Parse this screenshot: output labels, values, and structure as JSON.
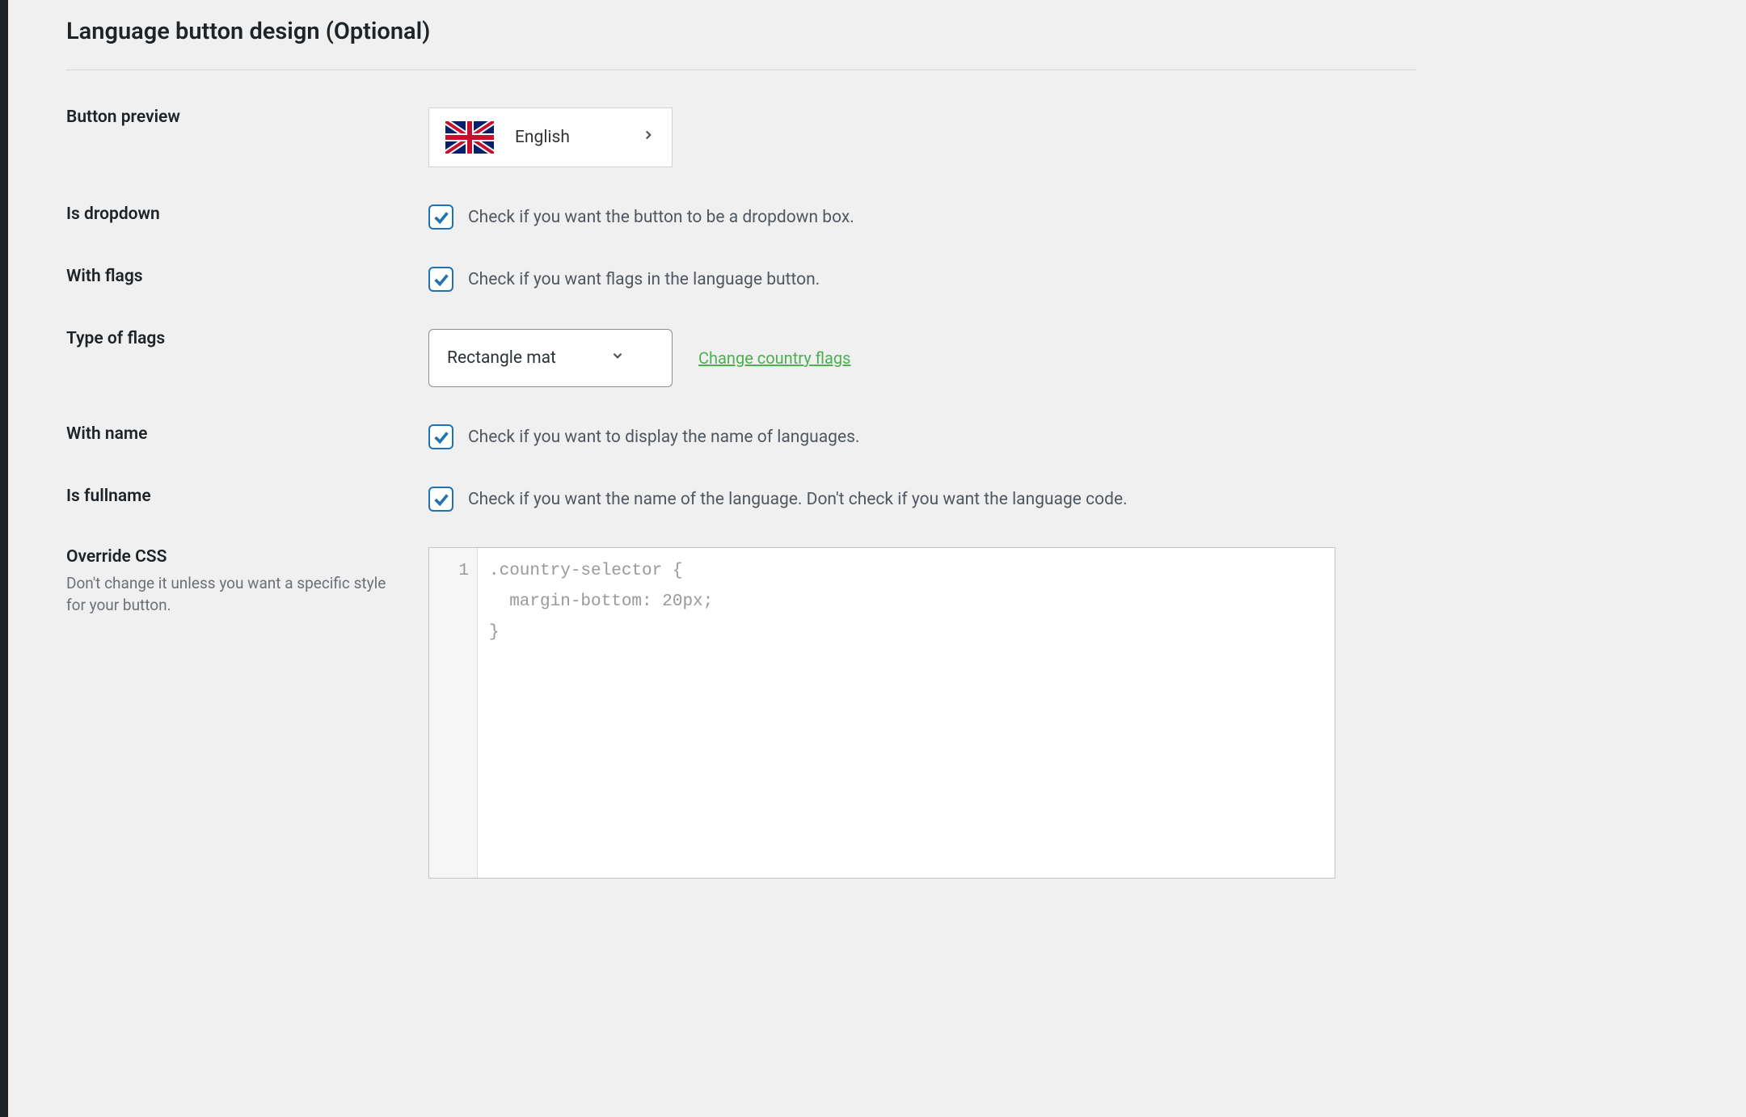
{
  "section": {
    "title": "Language button design (Optional)"
  },
  "rows": {
    "preview": {
      "label": "Button preview",
      "language": "English"
    },
    "dropdown": {
      "label": "Is dropdown",
      "desc": "Check if you want the button to be a dropdown box."
    },
    "flags": {
      "label": "With flags",
      "desc": "Check if you want flags in the language button."
    },
    "flag_type": {
      "label": "Type of flags",
      "select": "Rectangle mat",
      "link": "Change country flags"
    },
    "with_name": {
      "label": "With name",
      "desc": "Check if you want to display the name of languages."
    },
    "fullname": {
      "label": "Is fullname",
      "desc": "Check if you want the name of the language. Don't check if you want the language code."
    },
    "override": {
      "label": "Override CSS",
      "sub": "Don't change it unless you want a specific style for your button."
    }
  },
  "code": {
    "line_number": "1",
    "content": ".country-selector {\n  margin-bottom: 20px;\n}"
  }
}
